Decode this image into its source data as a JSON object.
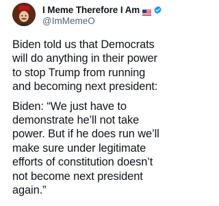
{
  "tweet": {
    "author": {
      "display_name": "I Meme Therefore I Am",
      "flag": "flag-us-icon",
      "verified": "verified-badge-icon",
      "handle": "@ImMemeO"
    },
    "paragraphs": [
      {
        "lines": [
          "Biden told us that Democrats",
          "will do anything in their power",
          "to stop Trump from running",
          "and becoming next president:"
        ]
      },
      {
        "lines": [
          "Biden: “We just have to",
          "demonstrate he’ll not take",
          "power. But if he does run we’ll",
          "make sure under legitimate",
          "efforts of constitution doesn’t",
          "not become next president",
          "again.”"
        ]
      }
    ]
  },
  "colors": {
    "text_primary": "#0f1419",
    "text_secondary": "#536471",
    "verified_blue": "#1d9bf0",
    "background": "#ffffff"
  }
}
